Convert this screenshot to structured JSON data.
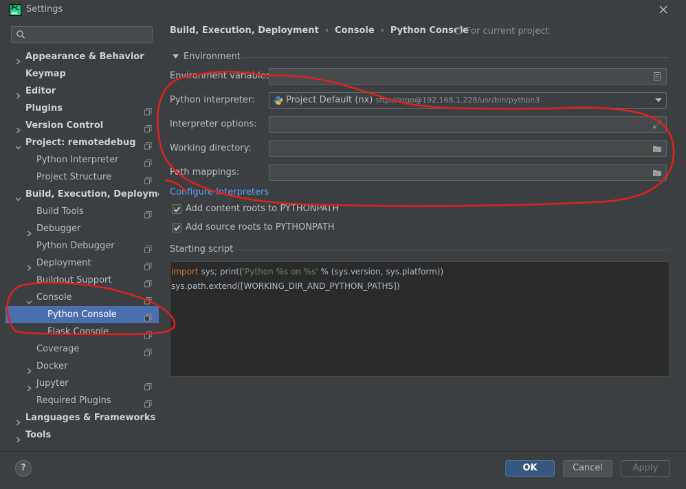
{
  "window": {
    "title": "Settings",
    "logo_text": "PC"
  },
  "search": {
    "value": "",
    "placeholder": ""
  },
  "tree": [
    {
      "label": "Appearance & Behavior",
      "level": 0,
      "bold": true,
      "chevron": "right",
      "proj": false
    },
    {
      "label": "Keymap",
      "level": 0,
      "bold": true,
      "chevron": "none",
      "proj": false
    },
    {
      "label": "Editor",
      "level": 0,
      "bold": true,
      "chevron": "right",
      "proj": false
    },
    {
      "label": "Plugins",
      "level": 0,
      "bold": true,
      "chevron": "none",
      "proj": true
    },
    {
      "label": "Version Control",
      "level": 0,
      "bold": true,
      "chevron": "right",
      "proj": true
    },
    {
      "label": "Project: remotedebug",
      "level": 0,
      "bold": true,
      "chevron": "down",
      "proj": true
    },
    {
      "label": "Python Interpreter",
      "level": 1,
      "bold": false,
      "chevron": "none",
      "proj": true
    },
    {
      "label": "Project Structure",
      "level": 1,
      "bold": false,
      "chevron": "none",
      "proj": true
    },
    {
      "label": "Build, Execution, Deployment",
      "level": 0,
      "bold": true,
      "chevron": "down",
      "proj": false
    },
    {
      "label": "Build Tools",
      "level": 1,
      "bold": false,
      "chevron": "none",
      "proj": true
    },
    {
      "label": "Debugger",
      "level": 1,
      "bold": false,
      "chevron": "right",
      "proj": false
    },
    {
      "label": "Python Debugger",
      "level": 1,
      "bold": false,
      "chevron": "none",
      "proj": true
    },
    {
      "label": "Deployment",
      "level": 1,
      "bold": false,
      "chevron": "right",
      "proj": true
    },
    {
      "label": "Buildout Support",
      "level": 1,
      "bold": false,
      "chevron": "none",
      "proj": true
    },
    {
      "label": "Console",
      "level": 1,
      "bold": false,
      "chevron": "down",
      "proj": true
    },
    {
      "label": "Python Console",
      "level": 2,
      "bold": false,
      "chevron": "none",
      "proj": true,
      "selected": true
    },
    {
      "label": "Flask Console",
      "level": 2,
      "bold": false,
      "chevron": "none",
      "proj": true
    },
    {
      "label": "Coverage",
      "level": 1,
      "bold": false,
      "chevron": "none",
      "proj": true
    },
    {
      "label": "Docker",
      "level": 1,
      "bold": false,
      "chevron": "right",
      "proj": false
    },
    {
      "label": "Jupyter",
      "level": 1,
      "bold": false,
      "chevron": "right",
      "proj": true
    },
    {
      "label": "Required Plugins",
      "level": 1,
      "bold": false,
      "chevron": "none",
      "proj": true
    },
    {
      "label": "Languages & Frameworks",
      "level": 0,
      "bold": true,
      "chevron": "right",
      "proj": false
    },
    {
      "label": "Tools",
      "level": 0,
      "bold": true,
      "chevron": "right",
      "proj": false
    }
  ],
  "breadcrumb": [
    "Build, Execution, Deployment",
    "Console",
    "Python Console"
  ],
  "breadcrumb_sep": "›",
  "for_project": "For current project",
  "environment": {
    "section_title": "Environment",
    "env_vars_label": "Environment variables:",
    "env_vars_value": "",
    "interpreter_label": "Python interpreter:",
    "interpreter_name": "Project Default (nx)",
    "interpreter_path": "sftp://argo@192.168.1.228/usr/bin/python3",
    "interp_options_label": "Interpreter options:",
    "interp_options_value": "",
    "working_dir_label": "Working directory:",
    "working_dir_value": "",
    "path_mappings_label": "Path mappings:",
    "path_mappings_value": "",
    "configure_link": "Configure Interpreters"
  },
  "checks": [
    {
      "label": "Add content roots to PYTHONPATH",
      "checked": true
    },
    {
      "label": "Add source roots to PYTHONPATH",
      "checked": true
    }
  ],
  "script": {
    "section_title": "Starting script",
    "line1_kw": "import",
    "line1_a": " sys; print(",
    "line1_str": "'Python %s on %s'",
    "line1_b": " % (sys.version, sys.platform))",
    "line2": "sys.path.extend([WORKING_DIR_AND_PYTHON_PATHS])"
  },
  "buttons": {
    "help": "?",
    "ok": "OK",
    "cancel": "Cancel",
    "apply": "Apply"
  },
  "colors": {
    "accent": "#4b6eaf",
    "link": "#589df6",
    "annotation": "#e0201b",
    "background": "#3c3f41"
  }
}
